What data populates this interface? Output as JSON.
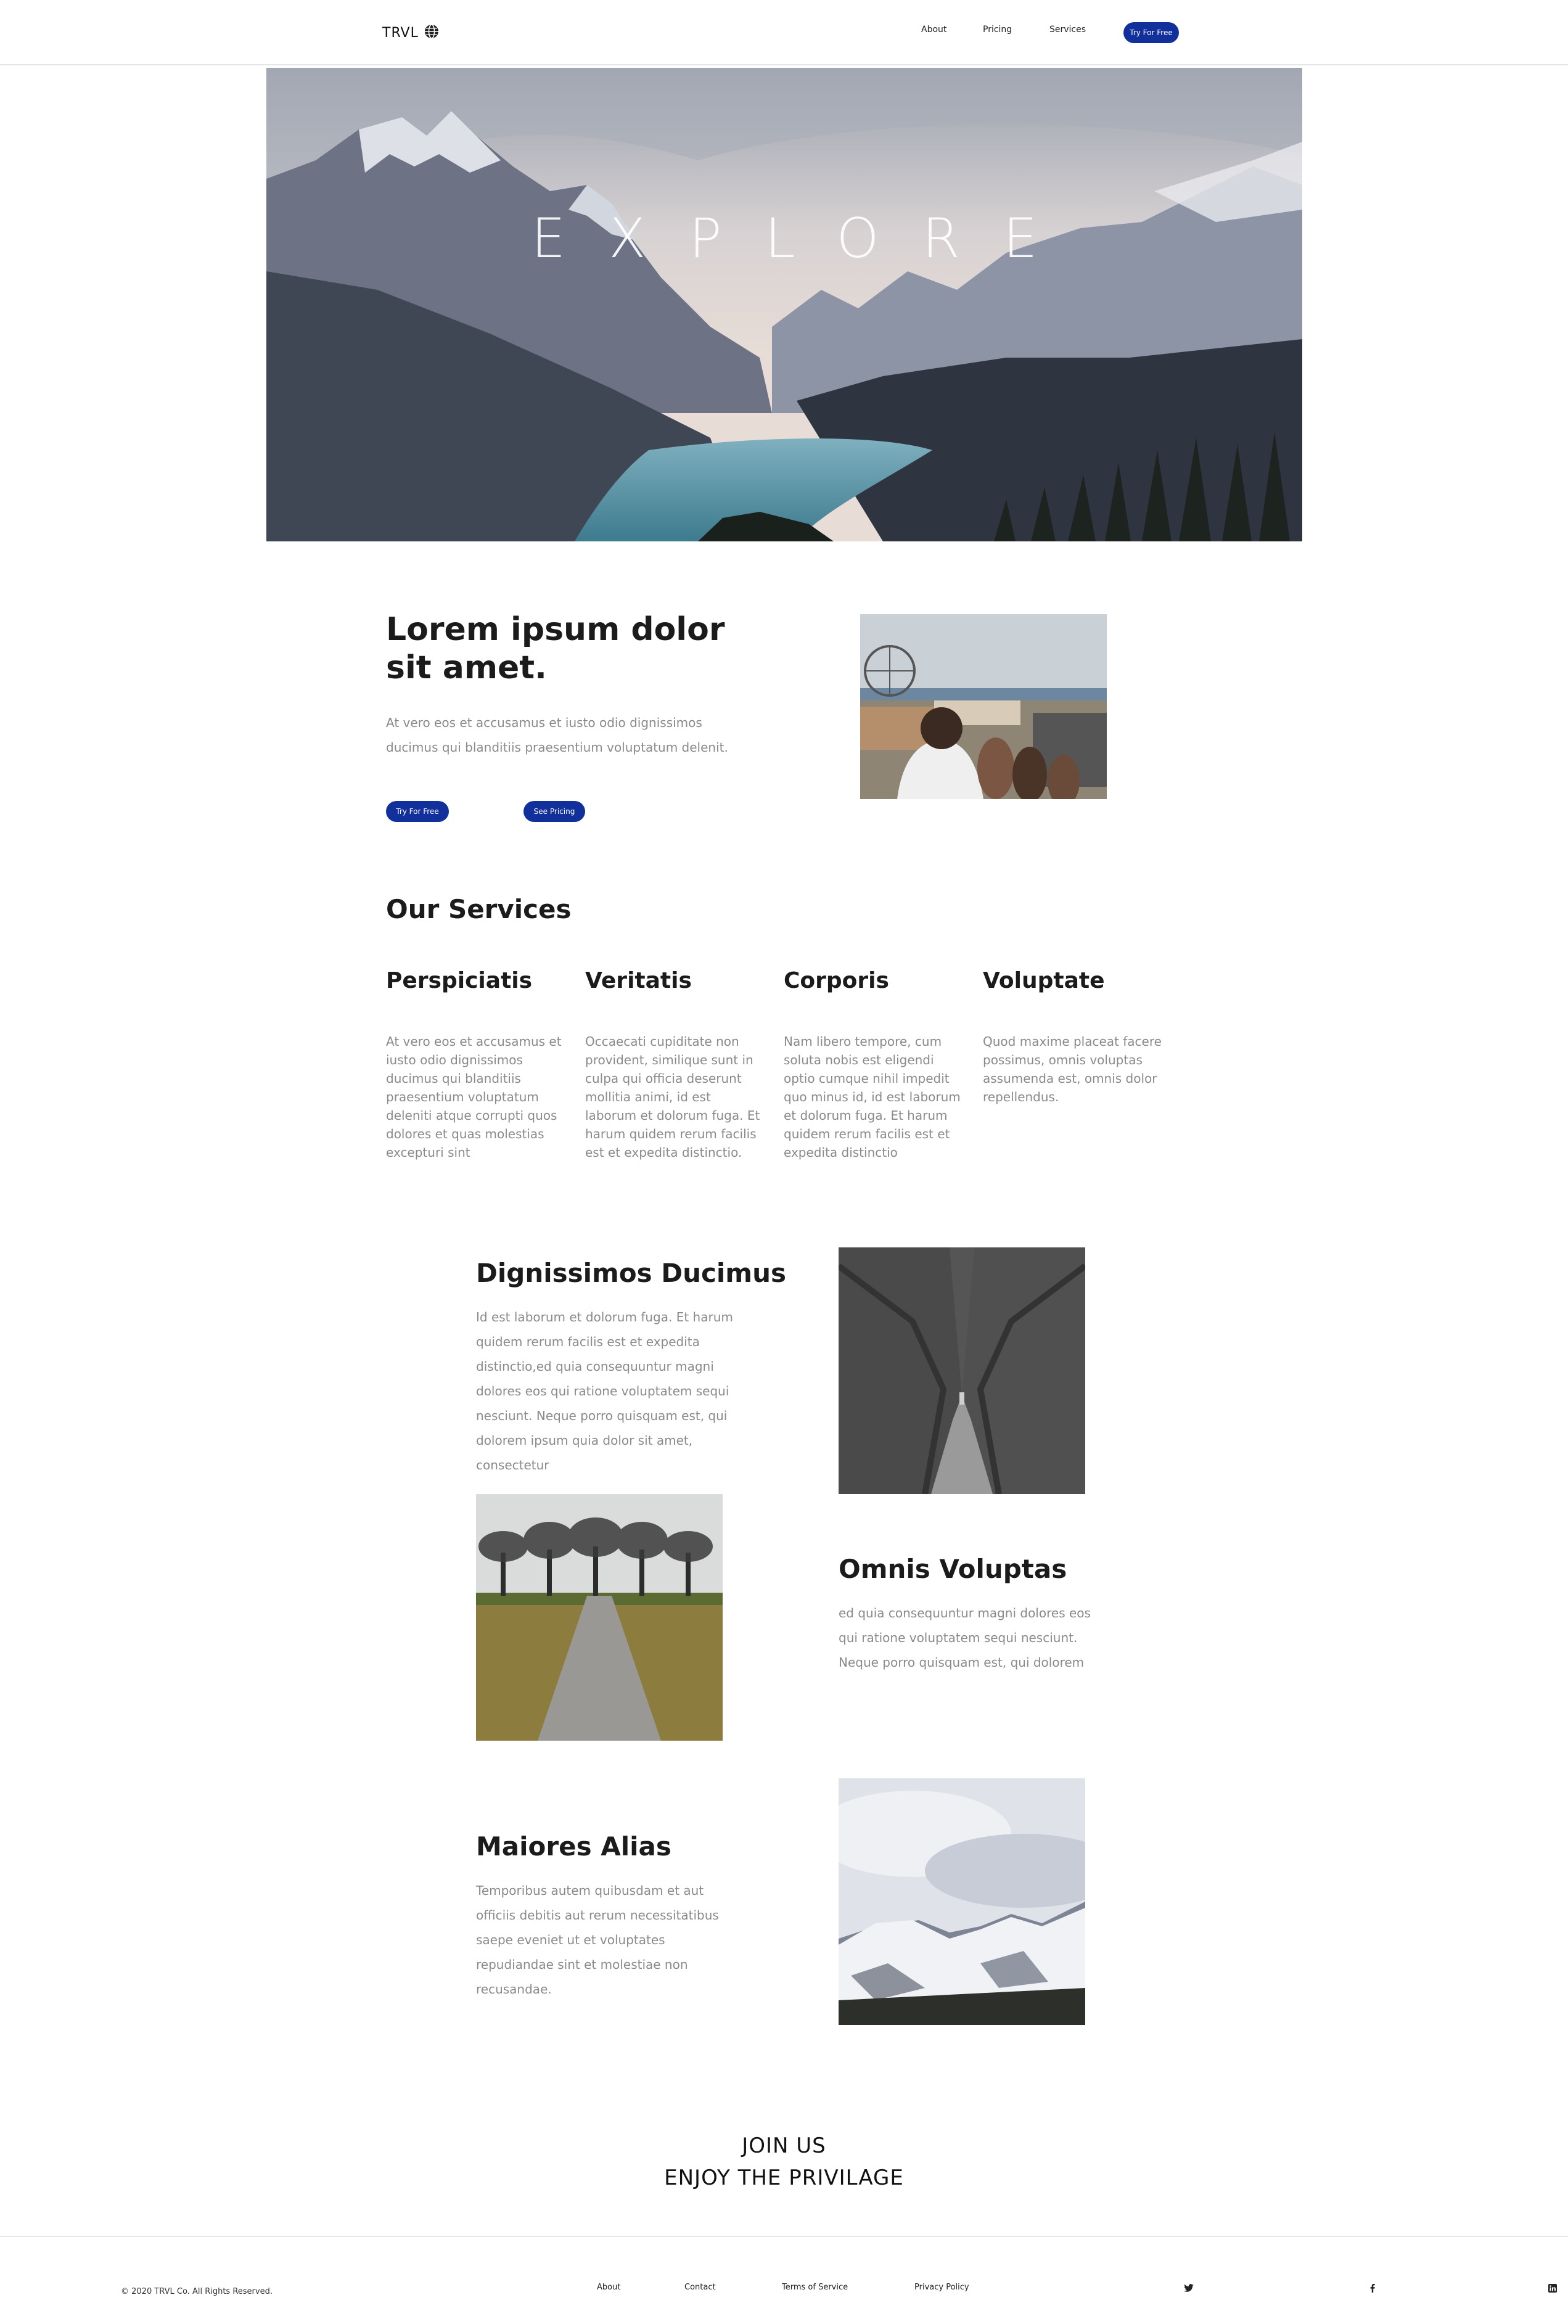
{
  "header": {
    "brand": "TRVL",
    "nav": [
      "About",
      "Pricing",
      "Services"
    ],
    "cta": "Try For Free"
  },
  "hero": {
    "title": "EXPLORE"
  },
  "intro": {
    "title": "Lorem ipsum dolor sit amet.",
    "text": "At vero eos et accusamus et iusto odio dignissimos ducimus qui blanditiis praesentium voluptatum delenit.",
    "primary_button": "Try For Free",
    "secondary_button": "See Pricing"
  },
  "services": {
    "title": "Our Services",
    "items": [
      {
        "name": "Perspiciatis",
        "text": "At vero eos et accusamus et iusto odio dignissimos ducimus qui blanditiis praesentium voluptatum deleniti atque corrupti quos dolores et quas molestias excepturi sint"
      },
      {
        "name": "Veritatis",
        "text": "Occaecati cupiditate non provident, similique sunt in culpa qui officia deserunt mollitia animi, id est laborum et dolorum fuga. Et harum quidem rerum facilis est et expedita distinctio."
      },
      {
        "name": "Corporis",
        "text": "Nam libero tempore, cum soluta nobis est eligendi optio cumque nihil impedit quo minus id, id est laborum et dolorum fuga. Et harum quidem rerum facilis est et expedita distinctio"
      },
      {
        "name": "Voluptate",
        "text": "Quod maxime placeat facere possimus, omnis voluptas assumenda est, omnis dolor repellendus."
      }
    ]
  },
  "features": [
    {
      "title": "Dignissimos Ducimus",
      "text": "Id est laborum et dolorum fuga. Et harum quidem rerum facilis est et expedita distinctio,ed quia consequuntur magni dolores eos qui ratione voluptatem sequi nesciunt. Neque porro quisquam est, qui dolorem ipsum quia dolor sit amet, consectetur"
    },
    {
      "title": "Omnis Voluptas",
      "text": "ed quia consequuntur magni dolores eos qui ratione voluptatem sequi nesciunt. Neque porro quisquam est, qui dolorem"
    },
    {
      "title": "Maiores Alias",
      "text": "Temporibus autem quibusdam et aut officiis debitis aut rerum necessitatibus saepe eveniet ut et voluptates repudiandae sint et molestiae non recusandae."
    }
  ],
  "join": {
    "line1": "JOIN US",
    "line2": "ENJOY THE PRIVILAGE"
  },
  "footer": {
    "copyright": "© 2020 TRVL Co. All Rights Reserved.",
    "links": [
      "About",
      "Contact",
      "Terms of Service",
      "Privacy Policy"
    ],
    "social": [
      "twitter-icon",
      "facebook-icon",
      "linkedin-icon"
    ]
  },
  "colors": {
    "accent": "#12309c",
    "muted_text": "#8a8a8a"
  }
}
